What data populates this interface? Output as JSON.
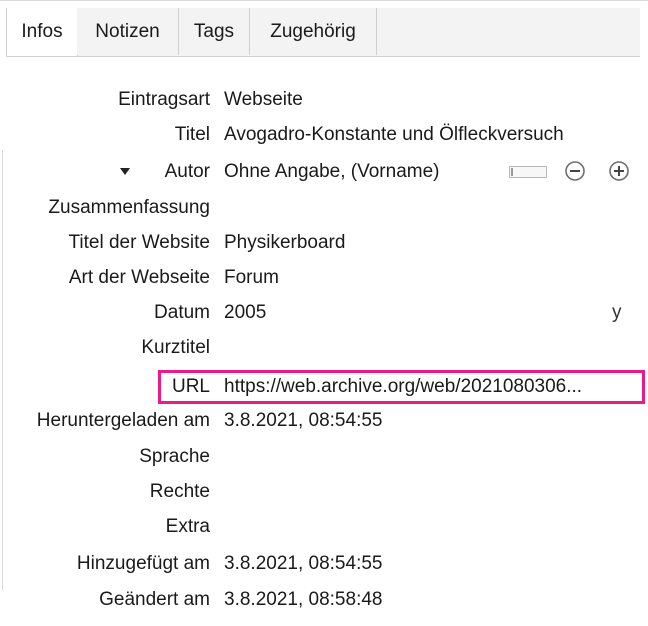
{
  "tabs": [
    {
      "label": "Infos",
      "active": true
    },
    {
      "label": "Notizen",
      "active": false
    },
    {
      "label": "Tags",
      "active": false
    },
    {
      "label": "Zugehörig",
      "active": false
    }
  ],
  "fields": {
    "item_type": {
      "label": "Eintragsart",
      "value": "Webseite"
    },
    "title": {
      "label": "Titel",
      "value": "Avogadro-Konstante und Ölfleckversuch"
    },
    "author": {
      "label": "Autor",
      "value": "Ohne Angabe, (Vorname)"
    },
    "abstract": {
      "label": "Zusammenfassung",
      "value": ""
    },
    "website_title": {
      "label": "Titel der Website",
      "value": "Physikerboard"
    },
    "website_type": {
      "label": "Art der Webseite",
      "value": "Forum"
    },
    "date": {
      "label": "Datum",
      "value": "2005",
      "suffix": "y"
    },
    "short_title": {
      "label": "Kurztitel",
      "value": ""
    },
    "url": {
      "label": "URL",
      "value": "https://web.archive.org/web/2021080306..."
    },
    "accessed": {
      "label": "Heruntergeladen am",
      "value": "3.8.2021, 08:54:55"
    },
    "language": {
      "label": "Sprache",
      "value": ""
    },
    "rights": {
      "label": "Rechte",
      "value": ""
    },
    "extra": {
      "label": "Extra",
      "value": ""
    },
    "date_added": {
      "label": "Hinzugefügt am",
      "value": "3.8.2021, 08:54:55"
    },
    "date_modified": {
      "label": "Geändert am",
      "value": "3.8.2021, 08:58:48"
    }
  },
  "icons": {
    "author_twisty": "triangle-down-icon",
    "remove_creator": "minus-circle-icon",
    "add_creator": "plus-circle-icon"
  },
  "colors": {
    "highlight": "#ea1a8a"
  }
}
